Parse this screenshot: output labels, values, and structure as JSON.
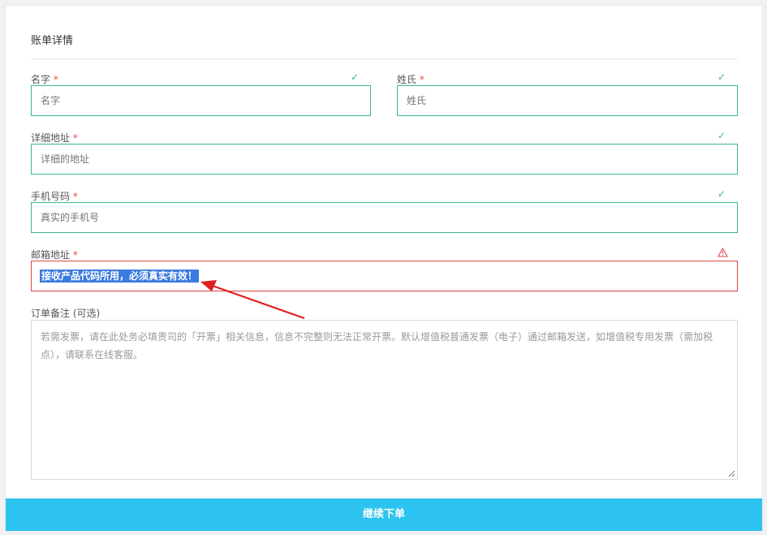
{
  "form": {
    "title": "账单详情",
    "first_name": {
      "label": "名字",
      "required": "*",
      "placeholder": "名字"
    },
    "last_name": {
      "label": "姓氏",
      "required": "*",
      "placeholder": "姓氏"
    },
    "address": {
      "label": "详细地址",
      "required": "*",
      "placeholder": "详细的地址"
    },
    "phone": {
      "label": "手机号码",
      "required": "*",
      "placeholder": "真实的手机号"
    },
    "email": {
      "label": "邮箱地址",
      "required": "*",
      "selected_text": "接收产品代码所用，必须真实有效！"
    },
    "notes": {
      "label": "订单备注 (可选)",
      "placeholder": "若需发票，请在此处务必填贵司的「开票」相关信息，信息不完整则无法正常开票。默认增值税普通发票（电子）通过邮箱发送，如增值税专用发票（需加税点），请联系在线客服。"
    },
    "submit_label": "继续下单"
  },
  "status_icons": {
    "valid": "check-icon",
    "invalid": "warning-triangle-icon"
  },
  "colors": {
    "valid": "#3bb88a",
    "invalid": "#e04545",
    "required": "#e84c3d",
    "submit": "#2cc3f0",
    "selection": "#3b7be0",
    "annotation_arrow": "#e02020"
  }
}
